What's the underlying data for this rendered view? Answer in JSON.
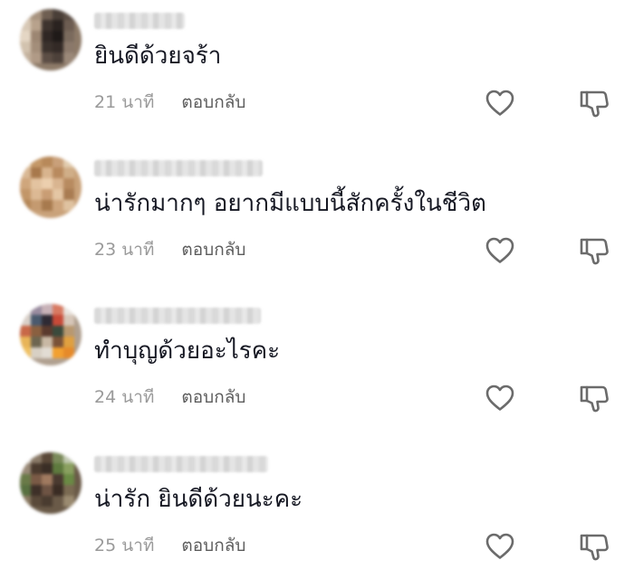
{
  "comments": [
    {
      "text": "ยินดีด้วยจร้า",
      "time": "21 นาที",
      "reply_label": "ตอบกลับ"
    },
    {
      "text": "น่ารักมากๆ อยากมีแบบนี้สักครั้งในชีวิต",
      "time": "23 นาที",
      "reply_label": "ตอบกลับ"
    },
    {
      "text": "ทำบุญด้วยอะไรคะ",
      "time": "24 นาที",
      "reply_label": "ตอบกลับ"
    },
    {
      "text": "น่ารัก ยินดีด้วยนะคะ",
      "time": "25 นาที",
      "reply_label": "ตอบกลับ"
    }
  ],
  "icons": {
    "like": "heart-outline-icon",
    "dislike": "thumbs-down-outline-icon"
  },
  "colors": {
    "text": "#161823",
    "timestamp": "#9a9a9a",
    "reply": "#5c5c5c",
    "icon_stroke": "#6b6b6b",
    "background": "#ffffff"
  }
}
